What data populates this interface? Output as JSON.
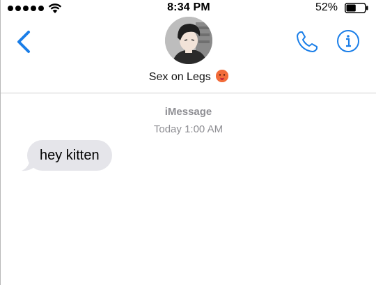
{
  "status_bar": {
    "time": "8:34 PM",
    "battery_percent_text": "52%",
    "battery_level": 0.52,
    "signal_bars": 5
  },
  "header": {
    "contact_name": "Sex on Legs",
    "contact_emoji_name": "hot-face-emoji",
    "back_icon": "chevron-left-icon",
    "phone_icon": "phone-icon",
    "info_icon": "info-icon"
  },
  "conversation": {
    "service": "iMessage",
    "timestamp": "Today 1:00 AM",
    "messages": [
      {
        "direction": "incoming",
        "text": "hey kitten"
      }
    ]
  },
  "colors": {
    "accent": "#1a7ee8",
    "bubble_incoming": "#e5e5ea",
    "meta_text": "#8e8e93"
  }
}
